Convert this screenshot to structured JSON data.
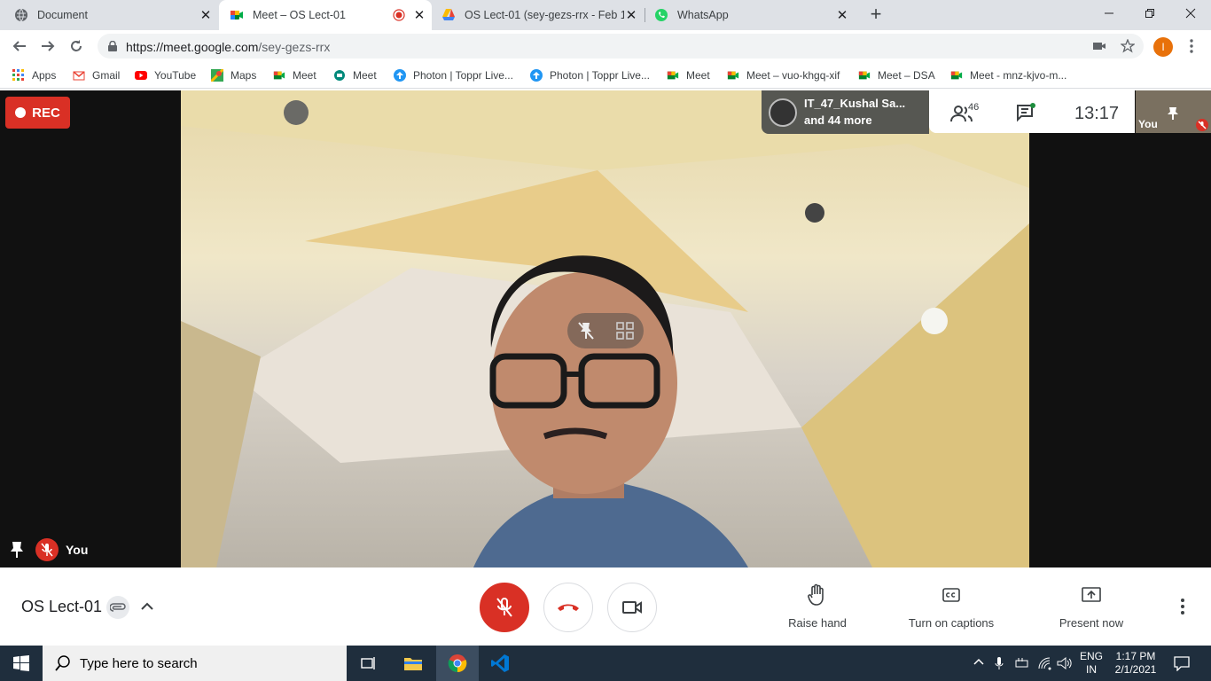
{
  "browser": {
    "tabs": [
      {
        "title": "Document",
        "close": "✕",
        "icon": "globe-icon"
      },
      {
        "title": "Meet – OS Lect-01",
        "close": "✕",
        "icon": "meet-icon",
        "recording": true
      },
      {
        "title": "OS Lect-01 (sey-gezs-rrx - Feb 1,",
        "close": "✕",
        "icon": "drive-icon"
      },
      {
        "title": "WhatsApp",
        "close": "✕",
        "icon": "whatsapp-icon"
      }
    ],
    "new_tab": "+",
    "url_host": "https://meet.google.com",
    "url_path": "/sey-gezs-rrx",
    "profile_initial": "I"
  },
  "bookmarks": [
    {
      "label": "Apps",
      "icon": "apps-grid-icon"
    },
    {
      "label": "Gmail",
      "icon": "gmail-icon"
    },
    {
      "label": "YouTube",
      "icon": "youtube-icon"
    },
    {
      "label": "Maps",
      "icon": "maps-icon"
    },
    {
      "label": "Meet",
      "icon": "meet-icon"
    },
    {
      "label": "Meet",
      "icon": "meet-old-icon"
    },
    {
      "label": "Photon | Toppr Live...",
      "icon": "toppr-icon"
    },
    {
      "label": "Photon | Toppr Live...",
      "icon": "toppr-icon"
    },
    {
      "label": "Meet",
      "icon": "meet-icon"
    },
    {
      "label": "Meet – vuo-khgq-xif",
      "icon": "meet-icon"
    },
    {
      "label": "Meet – DSA",
      "icon": "meet-icon"
    },
    {
      "label": "Meet - mnz-kjvo-m...",
      "icon": "meet-icon"
    }
  ],
  "meet": {
    "rec_label": "REC",
    "participant_name": "IT_47_Kushal Sa...",
    "participant_more": "and 44 more",
    "people_count": "46",
    "clock": "13:17",
    "self_label": "You",
    "self_bottom_label": "You",
    "meeting_name": "OS Lect-01",
    "actions": {
      "raise_hand": "Raise hand",
      "captions": "Turn on captions",
      "present": "Present now"
    },
    "colors": {
      "danger": "#d93025",
      "text": "#3c4043"
    }
  },
  "taskbar": {
    "search_placeholder": "Type here to search",
    "lang": "ENG",
    "region": "IN",
    "time": "1:17 PM",
    "date": "2/1/2021"
  }
}
